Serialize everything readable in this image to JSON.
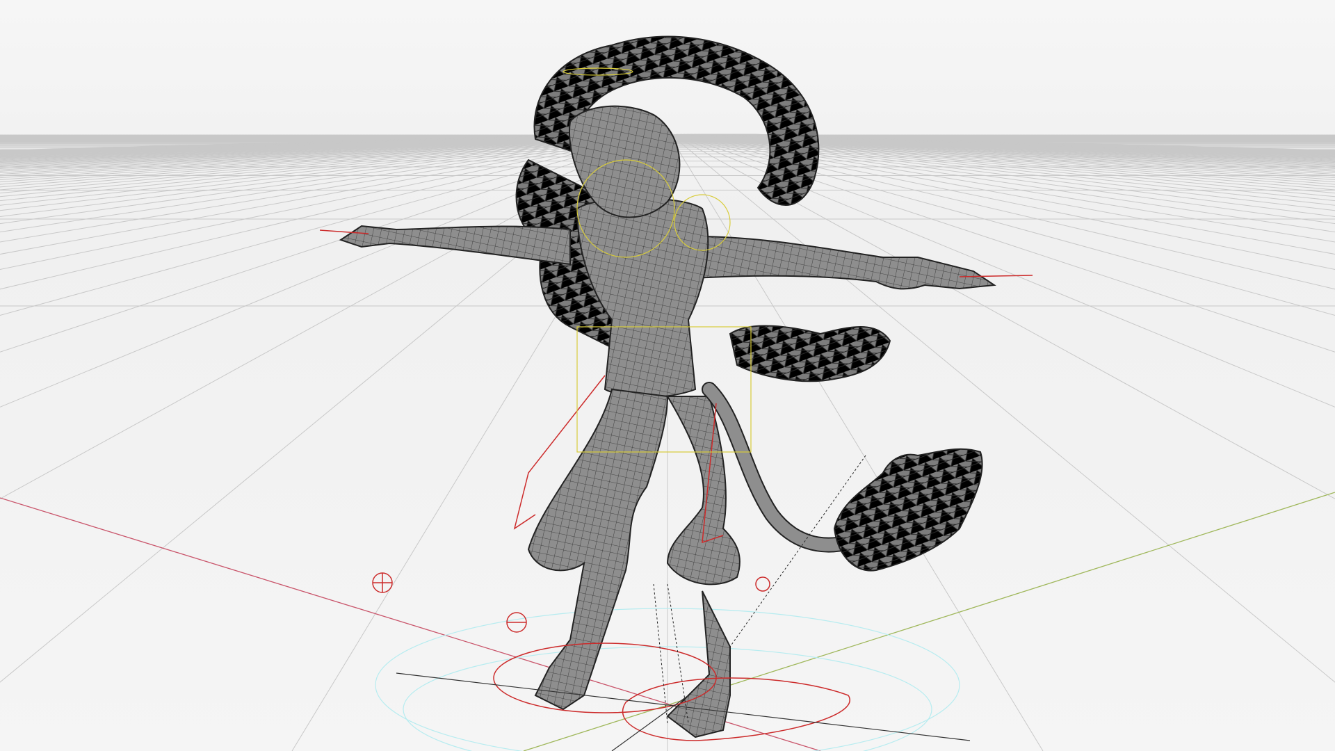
{
  "viewport": {
    "colors": {
      "background": "#f3f3f3",
      "grid": "#c8c8c8",
      "x_axis": "#c9546a",
      "y_axis": "#9fb75a",
      "mesh_fill": "#8c8c8c",
      "mesh_wire": "#2e2e2e",
      "rig_red": "#cc2a2a",
      "rig_yellow": "#d8cc3a",
      "rig_cyan": "#a8e8ee"
    }
  }
}
